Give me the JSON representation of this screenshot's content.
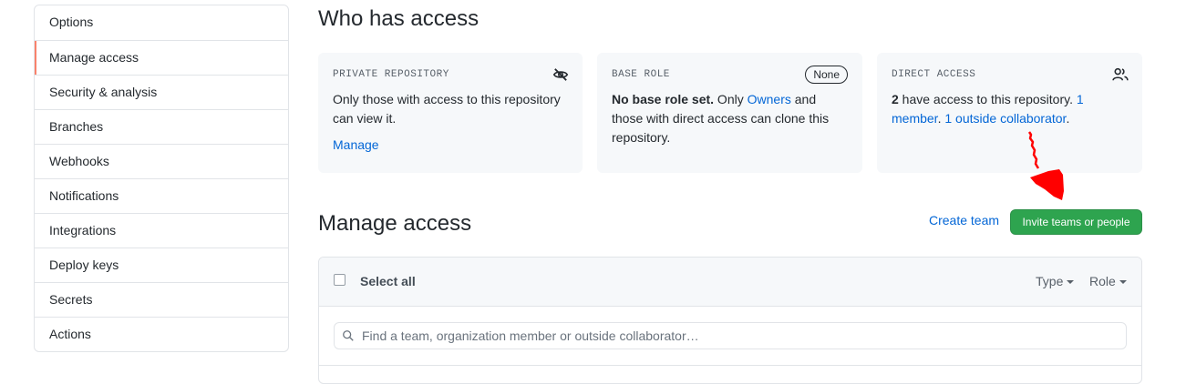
{
  "sidebar": {
    "items": [
      {
        "label": "Options"
      },
      {
        "label": "Manage access"
      },
      {
        "label": "Security & analysis"
      },
      {
        "label": "Branches"
      },
      {
        "label": "Webhooks"
      },
      {
        "label": "Notifications"
      },
      {
        "label": "Integrations"
      },
      {
        "label": "Deploy keys"
      },
      {
        "label": "Secrets"
      },
      {
        "label": "Actions"
      }
    ],
    "selected": "Manage access"
  },
  "who_has_access": {
    "title": "Who has access",
    "private_repo": {
      "label": "PRIVATE REPOSITORY",
      "text": "Only those with access to this repository can view it.",
      "link": "Manage",
      "icon": "eye-closed-icon"
    },
    "base_role": {
      "label": "BASE ROLE",
      "badge": "None",
      "bold": "No base role set.",
      "pre": " Only ",
      "link": "Owners",
      "post": " and those with direct access can clone this repository."
    },
    "direct_access": {
      "label": "DIRECT ACCESS",
      "count": "2",
      "text": " have access to this repository. ",
      "member_link": "1 member",
      "sep": ". ",
      "collab_link": "1 outside collaborator",
      "end": ".",
      "icon": "people-icon"
    }
  },
  "manage_access": {
    "title": "Manage access",
    "create_team": "Create team",
    "invite_button": "Invite teams or people",
    "select_all": "Select all",
    "type_filter": "Type",
    "role_filter": "Role",
    "search_placeholder": "Find a team, organization member or outside collaborator…"
  },
  "colors": {
    "accent": "#0366d6",
    "button_green": "#2ea44f",
    "selected_marker": "#f9826c",
    "annotation_red": "#ff0000"
  }
}
